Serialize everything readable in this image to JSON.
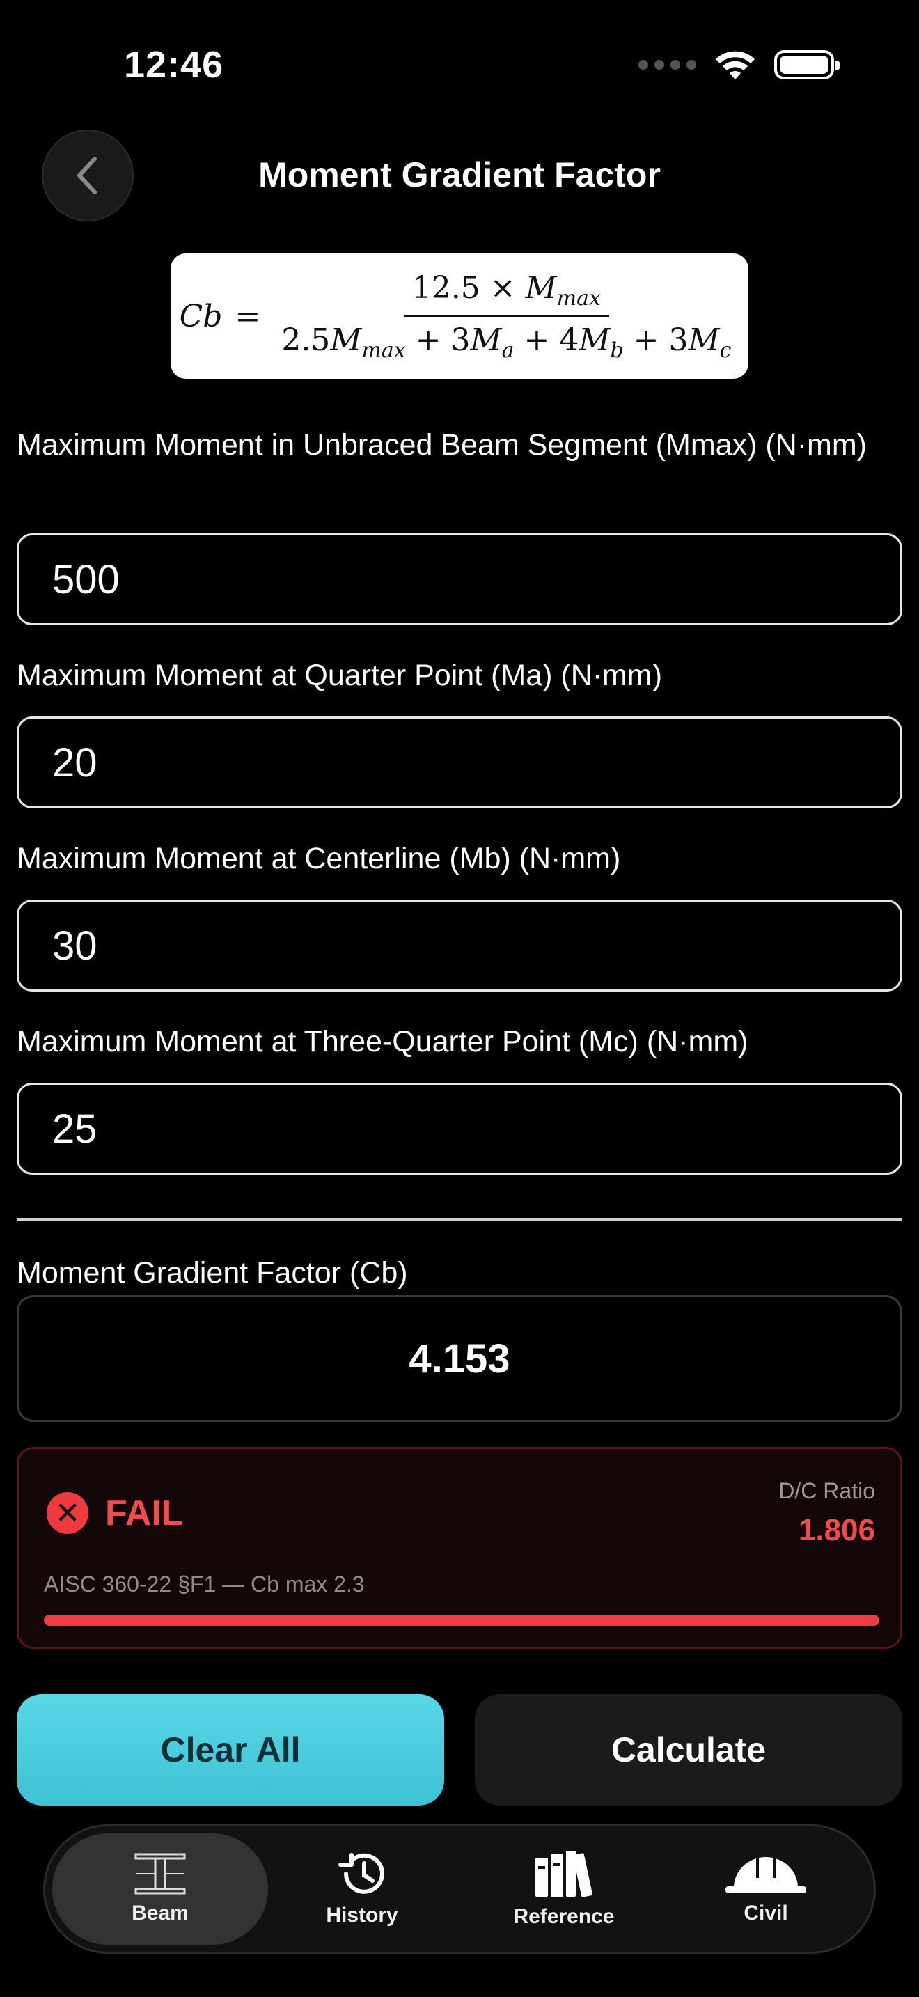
{
  "status": {
    "time": "12:46"
  },
  "header": {
    "title": "Moment Gradient Factor"
  },
  "formula": {
    "lhs": "Cb",
    "eq": "=",
    "numerator_const": "12.5",
    "times": "×",
    "m": "M",
    "sub_max": "max",
    "den_c1": "2.5",
    "den_c2": "3",
    "den_c3": "4",
    "den_c4": "3",
    "plus": "+",
    "sub_a": "a",
    "sub_b": "b",
    "sub_c": "c"
  },
  "fields": [
    {
      "label": "Maximum Moment in Unbraced Beam Segment (Mmax) (N·mm)",
      "value": "500"
    },
    {
      "label": "Maximum Moment at Quarter Point (Ma) (N·mm)",
      "value": "20"
    },
    {
      "label": "Maximum Moment at Centerline (Mb) (N·mm)",
      "value": "30"
    },
    {
      "label": "Maximum Moment at Three-Quarter Point (Mc) (N·mm)",
      "value": "25"
    }
  ],
  "result": {
    "label": "Moment Gradient Factor (Cb)",
    "value": "4.153"
  },
  "check": {
    "status": "FAIL",
    "dc_label": "D/C Ratio",
    "dc_value": "1.806",
    "code": "AISC 360-22 §F1 — Cb max 2.3",
    "ratio_fill": 1.0,
    "status_color": "#f24a4e"
  },
  "actions": {
    "clear": "Clear All",
    "calculate": "Calculate"
  },
  "tabs": [
    {
      "label": "Beam",
      "icon": "i-beam-icon",
      "active": true
    },
    {
      "label": "History",
      "icon": "history-icon",
      "active": false
    },
    {
      "label": "Reference",
      "icon": "books-icon",
      "active": false
    },
    {
      "label": "Civil",
      "icon": "hardhat-icon",
      "active": false
    }
  ]
}
